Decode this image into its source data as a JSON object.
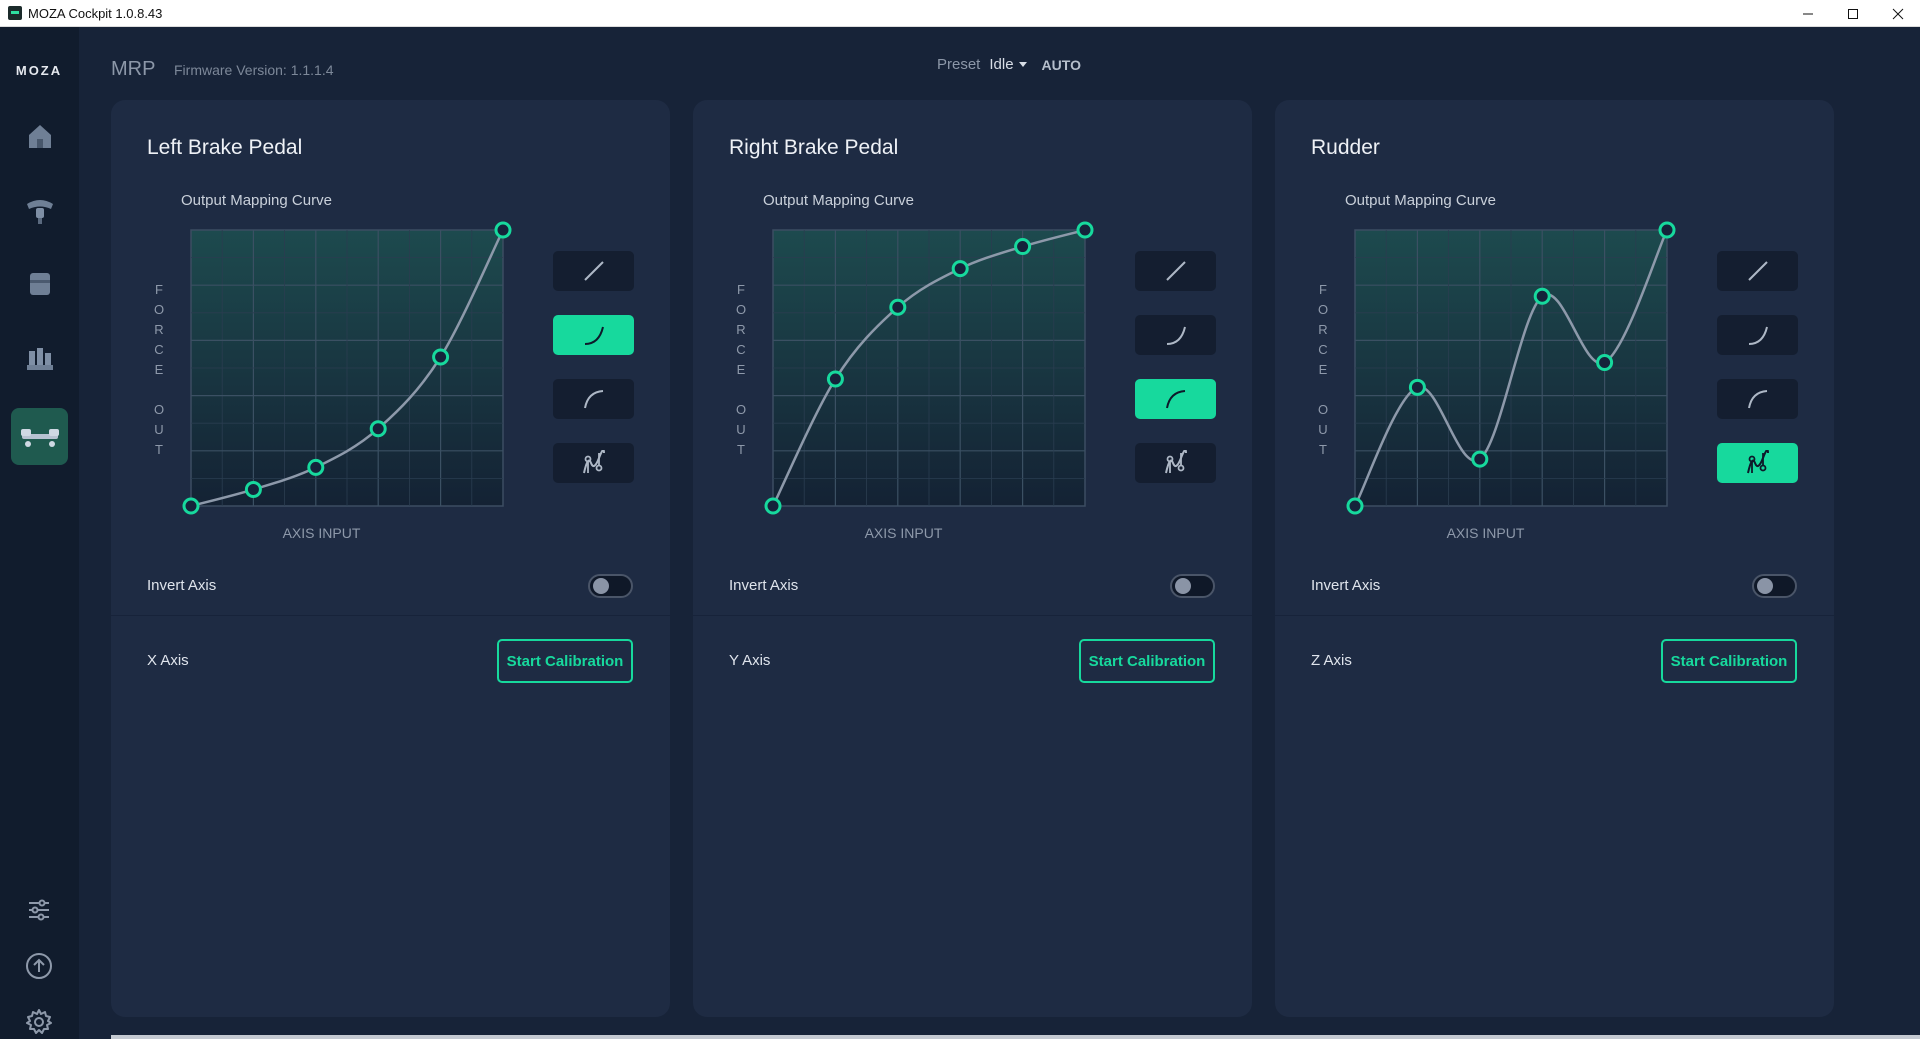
{
  "window": {
    "title": "MOZA Cockpit 1.0.8.43"
  },
  "sidebar": {
    "logo": "MOZA",
    "items": [
      {
        "name": "home-icon"
      },
      {
        "name": "wheel-icon"
      },
      {
        "name": "base-icon"
      },
      {
        "name": "pedals-icon"
      },
      {
        "name": "rudder-pedals-icon",
        "active": true
      }
    ],
    "bottom": [
      {
        "name": "sliders-icon"
      },
      {
        "name": "upload-icon"
      },
      {
        "name": "gear-icon"
      }
    ]
  },
  "header": {
    "device": "MRP",
    "firmware": "Firmware Version: 1.1.1.4",
    "preset_label": "Preset",
    "preset_value": "Idle",
    "auto": "AUTO"
  },
  "colors": {
    "accent": "#17d99d",
    "panel": "#1e2b43",
    "background": "#172338"
  },
  "panels": [
    {
      "title": "Left Brake Pedal",
      "curve_label": "Output Mapping Curve",
      "axis_label": "AXIS INPUT",
      "force_label": "FORCE OUT",
      "curve_points": [
        [
          0,
          0
        ],
        [
          0.2,
          0.06
        ],
        [
          0.4,
          0.14
        ],
        [
          0.6,
          0.28
        ],
        [
          0.8,
          0.54
        ],
        [
          1,
          1
        ]
      ],
      "selected_curve": 1,
      "invert_label": "Invert Axis",
      "invert": false,
      "axis_name": "X Axis",
      "calibrate": "Start Calibration"
    },
    {
      "title": "Right Brake Pedal",
      "curve_label": "Output Mapping Curve",
      "axis_label": "AXIS INPUT",
      "force_label": "FORCE OUT",
      "curve_points": [
        [
          0,
          0
        ],
        [
          0.2,
          0.46
        ],
        [
          0.4,
          0.72
        ],
        [
          0.6,
          0.86
        ],
        [
          0.8,
          0.94
        ],
        [
          1,
          1
        ]
      ],
      "selected_curve": 2,
      "invert_label": "Invert Axis",
      "invert": false,
      "axis_name": "Y Axis",
      "calibrate": "Start Calibration"
    },
    {
      "title": "Rudder",
      "curve_label": "Output Mapping Curve",
      "axis_label": "AXIS INPUT",
      "force_label": "FORCE OUT",
      "curve_points": [
        [
          0,
          0
        ],
        [
          0.2,
          0.43
        ],
        [
          0.4,
          0.17
        ],
        [
          0.6,
          0.76
        ],
        [
          0.8,
          0.52
        ],
        [
          1,
          1
        ]
      ],
      "selected_curve": 3,
      "invert_label": "Invert Axis",
      "invert": false,
      "axis_name": "Z Axis",
      "calibrate": "Start Calibration"
    }
  ],
  "curve_types": [
    "linear-curve-icon",
    "exponential-curve-icon",
    "logarithmic-curve-icon",
    "custom-curve-icon"
  ]
}
